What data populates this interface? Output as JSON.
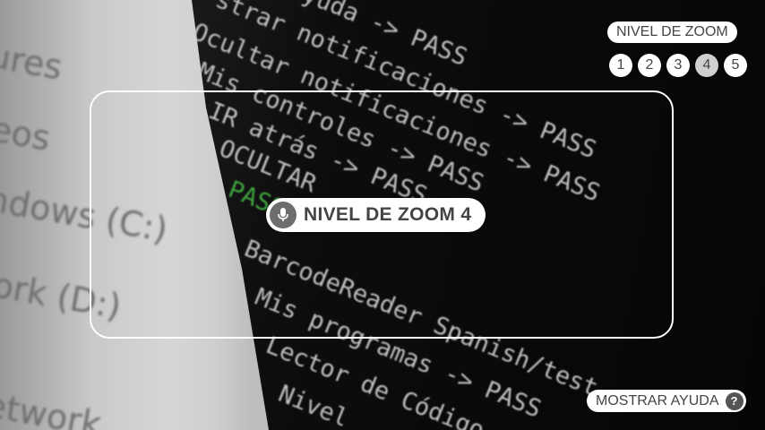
{
  "zoom_selector": {
    "header": "NIVEL DE ZOOM",
    "levels": [
      "1",
      "2",
      "3",
      "4",
      "5"
    ],
    "active_level": "4"
  },
  "status_pill": {
    "label": "NIVEL DE ZOOM 4",
    "icon": "mic-icon"
  },
  "help": {
    "label": "MOSTRAR AYUDA",
    "icon": "help-icon",
    "icon_glyph": "?"
  },
  "camera_view": {
    "left_screen_lines": [
      "ures",
      "eos",
      "ndows (C:)",
      "ork (D:)",
      "etwork"
    ],
    "code_lines": [
      "ayuda -> PASS",
      "strar notificaciones -> PASS",
      "Ocultar notificaciones -> PASS",
      "Mis controles -> PASS",
      "IR atrás -> PASS",
      "OCULTAR",
      "PASSED",
      "BarcodeReader Spanish/test",
      "Mis programas -> PASS",
      "Lector de Código",
      "Nivel"
    ]
  },
  "colors": {
    "pill_bg": "#ffffff",
    "pill_text": "#444444",
    "frame": "#ffffff",
    "active_level_bg": "#d0d0d0"
  }
}
